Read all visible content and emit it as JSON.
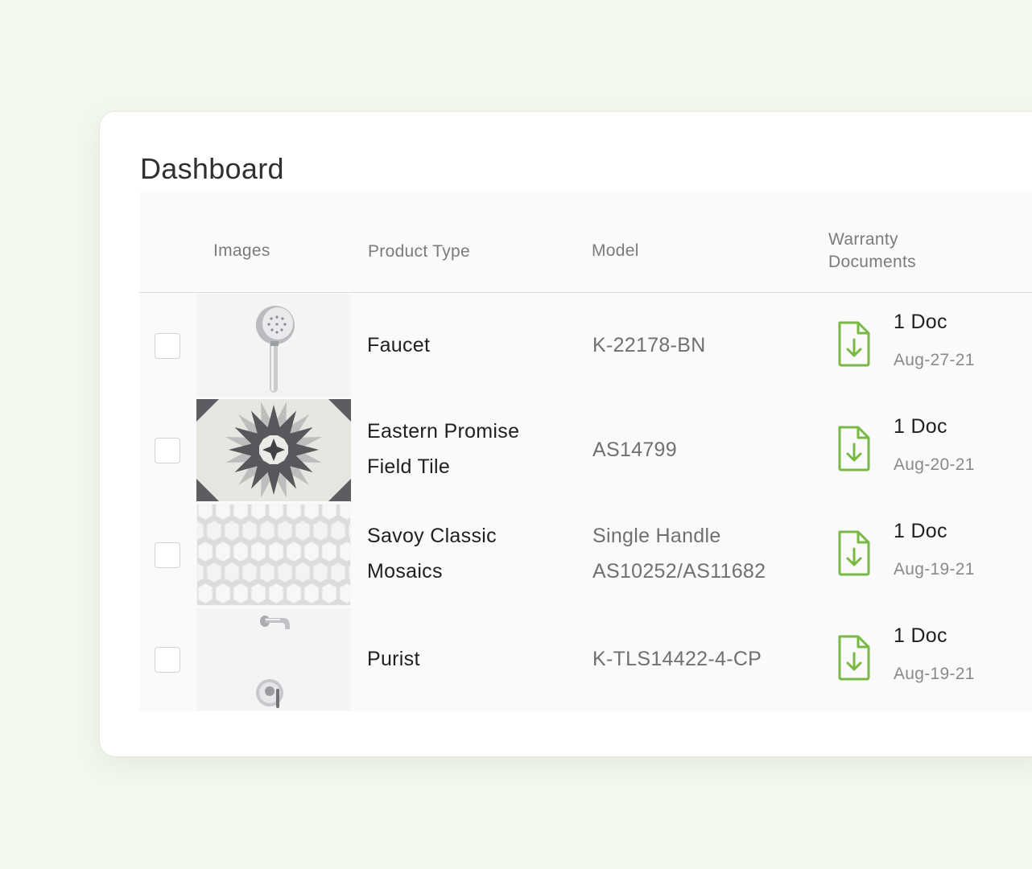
{
  "page": {
    "title": "Dashboard"
  },
  "columns": {
    "images": "Images",
    "product_type": "Product Type",
    "model": "Model",
    "warranty_line1": "Warranty",
    "warranty_line2": "Documents"
  },
  "colors": {
    "accent": "#78b843",
    "background": "#f3f8ee"
  },
  "rows": [
    {
      "image": "shower-head-image",
      "product_type": [
        "Faucet"
      ],
      "model": [
        "K-22178-BN"
      ],
      "doc_count": "1 Doc",
      "doc_date": "Aug-27-21",
      "checked": false
    },
    {
      "image": "star-tile-image",
      "product_type": [
        "Eastern Promise",
        "Field Tile"
      ],
      "model": [
        "AS14799"
      ],
      "doc_count": "1 Doc",
      "doc_date": "Aug-20-21",
      "checked": false
    },
    {
      "image": "hex-mosaic-image",
      "product_type": [
        "Savoy Classic",
        "Mosaics"
      ],
      "model": [
        "Single Handle",
        "AS10252/AS11682"
      ],
      "doc_count": "1 Doc",
      "doc_date": "Aug-19-21",
      "checked": false
    },
    {
      "image": "tub-spout-valve-image",
      "product_type": [
        "Purist"
      ],
      "model": [
        "K-TLS14422-4-CP"
      ],
      "doc_count": "1 Doc",
      "doc_date": "Aug-19-21",
      "checked": false
    }
  ]
}
